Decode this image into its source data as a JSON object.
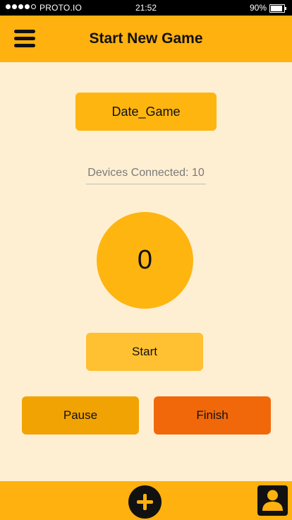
{
  "status_bar": {
    "carrier": "PROTO.IO",
    "time": "21:52",
    "battery": "90%",
    "battery_level": 0.9,
    "signal_bars": 4,
    "signal_max": 5
  },
  "header": {
    "title": "Start New Game",
    "menu_icon": "hamburger-menu-icon"
  },
  "game": {
    "name": "Date_Game",
    "devices_connected": "Devices Connected: 10",
    "counter": "0"
  },
  "buttons": {
    "start": "Start",
    "pause": "Pause",
    "finish": "Finish"
  },
  "bottom_bar": {
    "add_icon": "plus-circle-icon",
    "profile_icon": "user-profile-icon"
  },
  "colors": {
    "accent": "#FEB10F",
    "background": "#FFEFD2",
    "start": "#FFC131",
    "pause": "#F1A303",
    "finish": "#F1680A"
  }
}
